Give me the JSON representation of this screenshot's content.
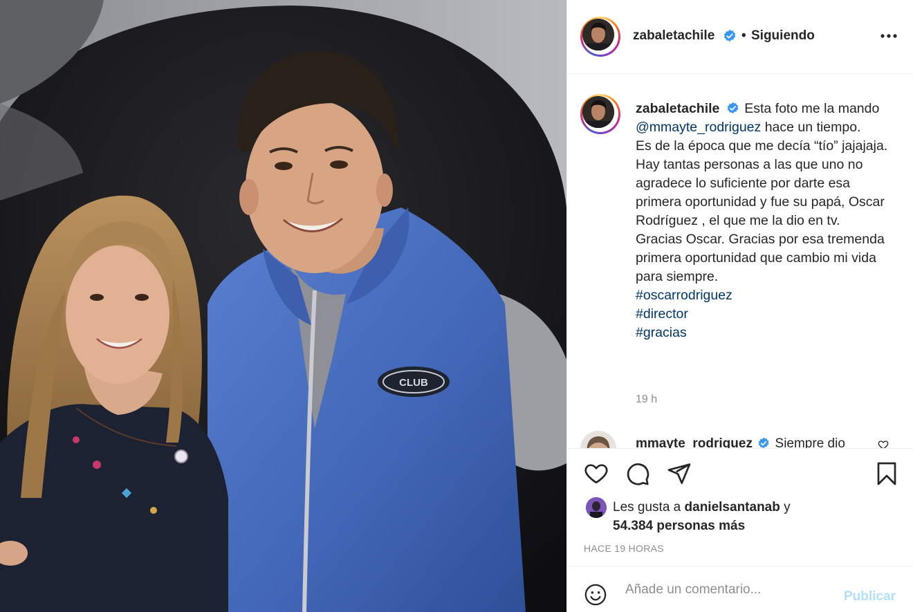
{
  "post": {
    "photo_alt": "",
    "photo_logo_text": "CLUB"
  },
  "header": {
    "username": "zabaletachile",
    "separator": "•",
    "follow_status": "Siguiendo",
    "avatar_icon": "avatar-photo",
    "verified_icon": "verified-badge-icon",
    "more_icon": "more-options-icon"
  },
  "caption": {
    "username": "zabaletachile",
    "text_1": "Esta foto me la mando ",
    "mention": "@mmayte_rodriguez",
    "text_2": " hace un tiempo.",
    "line_3": "Es de la época que me decía “tío” jajajaja.",
    "line_4": "Hay tantas personas a las que uno no agradece lo suficiente por darte esa primera oportunidad y fue su papá, Oscar Rodríguez , el que me la dio en tv.",
    "line_5": "Gracias Oscar. Gracias por esa tremenda primera oportunidad que cambio mi vida para siempre.",
    "hashtags": [
      "#oscarrodriguez",
      "#director",
      "#gracias"
    ],
    "timestamp": "19 h"
  },
  "next_comment": {
    "username": "mmayte_rodriguez",
    "text": "Siempre dio"
  },
  "actions": {
    "like_icon": "heart-icon",
    "comment_icon": "comment-icon",
    "share_icon": "share-icon",
    "save_icon": "bookmark-icon"
  },
  "likes": {
    "prefix": "Les gusta a ",
    "user": "danielsantanab",
    "middle": " y",
    "count": "54.384 personas más"
  },
  "time_ago": "HACE 19 HORAS",
  "comment_box": {
    "placeholder": "Añade un comentario...",
    "publish_label": "Publicar",
    "emoji_icon": "emoji-icon"
  },
  "colors": {
    "link": "#00376b",
    "verified": "#3897f0",
    "publish_disabled": "#b2dffc",
    "muted": "#8e8e8e",
    "vest_blue": "#4a6fc0"
  }
}
